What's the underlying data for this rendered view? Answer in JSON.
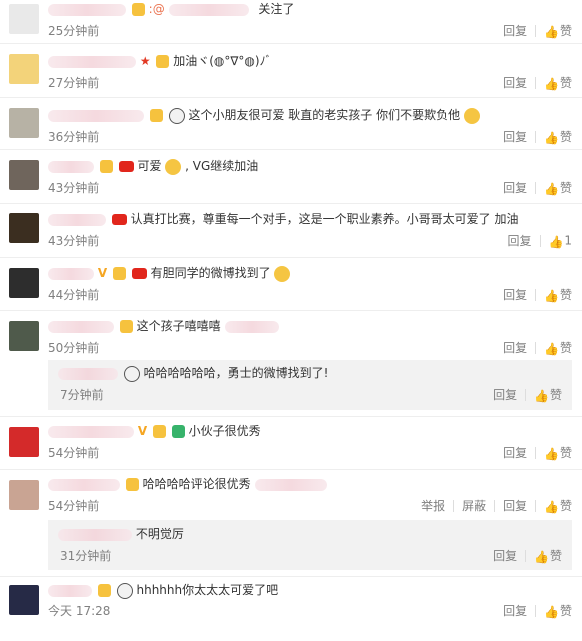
{
  "comments": [
    {
      "text": "关注了",
      "prefix": ":@",
      "time": "25分钟前",
      "actions": [
        "回复",
        "赞"
      ]
    },
    {
      "text": "加油ヾ(◍°∇°◍)ﾉﾞ",
      "time": "27分钟前",
      "actions": [
        "回复",
        "赞"
      ]
    },
    {
      "text": "这个小朋友很可爱 耿直的老实孩子 你们不要欺负他",
      "time": "36分钟前",
      "actions": [
        "回复",
        "赞"
      ]
    },
    {
      "text": "可爱",
      "text2": ", VG继续加油",
      "time": "43分钟前",
      "actions": [
        "回复",
        "赞"
      ]
    },
    {
      "text": "认真打比赛，尊重每一个对手，这是一个职业素养。小哥哥太可爱了 加油",
      "time": "43分钟前",
      "actions": [
        "回复",
        "1"
      ]
    },
    {
      "text": "有胆同学的微博找到了",
      "time": "44分钟前",
      "actions": [
        "回复",
        "赞"
      ]
    },
    {
      "text": "这个孩子嘻嘻嘻",
      "time": "50分钟前",
      "actions": [
        "回复",
        "赞"
      ]
    },
    {
      "text": "哈哈哈哈哈哈，勇士的微博找到了!",
      "time": "7分钟前",
      "actions": [
        "回复",
        "赞"
      ]
    },
    {
      "text": "小伙子很优秀",
      "time": "54分钟前",
      "actions": [
        "回复",
        "赞"
      ]
    },
    {
      "text": "哈哈哈哈评论很优秀",
      "time": "54分钟前",
      "actions": [
        "举报",
        "屏蔽",
        "回复",
        "赞"
      ]
    },
    {
      "text": "不明觉厉",
      "time": "31分钟前",
      "actions": [
        "回复",
        "赞"
      ]
    },
    {
      "text": "hhhhhh你太太太可爱了吧",
      "time": "今天 17:28",
      "actions": [
        "回复",
        "赞"
      ]
    }
  ],
  "colors": {
    "mention": "#eb7350",
    "muted": "#808080",
    "reply_bg": "#f2f2f2"
  }
}
